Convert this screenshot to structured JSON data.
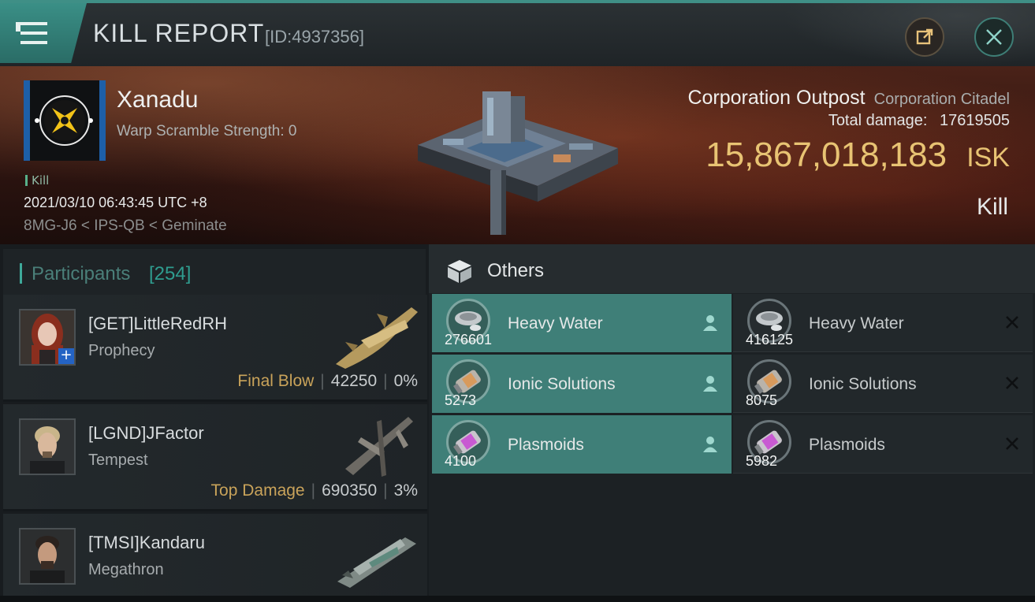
{
  "header": {
    "title": "KILL REPORT",
    "report_id": "[ID:4937356]"
  },
  "victim": {
    "name": "Xanadu",
    "warp_scramble": "Warp Scramble Strength: 0",
    "tag": "Kill",
    "datetime": "2021/03/10 06:43:45 UTC +8",
    "location": "8MG-J6 < IPS-QB < Geminate",
    "structure_name": "Corporation Outpost",
    "structure_type": "Corporation Citadel",
    "damage_label": "Total damage:",
    "damage_value": "17619505",
    "isk_value": "15,867,018,183",
    "isk_unit": "ISK",
    "result": "Kill"
  },
  "participants": {
    "label": "Participants",
    "count": "[254]",
    "rows": [
      {
        "name": "[GET]LittleRedRH",
        "ship": "Prophecy",
        "label": "Final Blow",
        "damage": "42250",
        "percent": "0%"
      },
      {
        "name": "[LGND]JFactor",
        "ship": "Tempest",
        "label": "Top Damage",
        "damage": "690350",
        "percent": "3%"
      },
      {
        "name": "[TMSI]Kandaru",
        "ship": "Megathron",
        "label": "",
        "damage": "",
        "percent": ""
      }
    ]
  },
  "others": {
    "label": "Others",
    "dropped": [
      {
        "name": "Heavy Water",
        "qty": "276601"
      },
      {
        "name": "Ionic Solutions",
        "qty": "5273"
      },
      {
        "name": "Plasmoids",
        "qty": "4100"
      }
    ],
    "destroyed": [
      {
        "name": "Heavy Water",
        "qty": "416125"
      },
      {
        "name": "Ionic Solutions",
        "qty": "8075"
      },
      {
        "name": "Plasmoids",
        "qty": "5982"
      }
    ]
  },
  "colors": {
    "accent": "#3f8f86",
    "isk_gold": "#e8c373",
    "dropped_bg": "#3f7f78"
  }
}
